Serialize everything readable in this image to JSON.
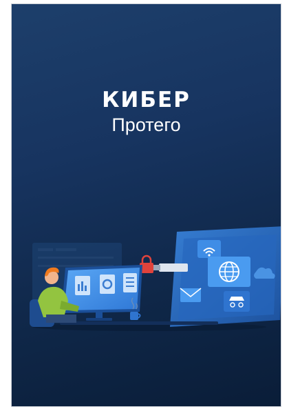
{
  "cover": {
    "brand_main": "КИБЕР",
    "brand_sub": "Протего"
  },
  "colors": {
    "background_top": "#1d3f6b",
    "background_bottom": "#0a1d38",
    "panel": "#2c6fc9",
    "accent_red": "#e0433c",
    "text": "#ffffff"
  },
  "icons": [
    "wifi-icon",
    "globe-icon",
    "lock-icon",
    "usb-drive-icon",
    "envelope-icon",
    "document-icon",
    "coffee-cup-icon"
  ]
}
